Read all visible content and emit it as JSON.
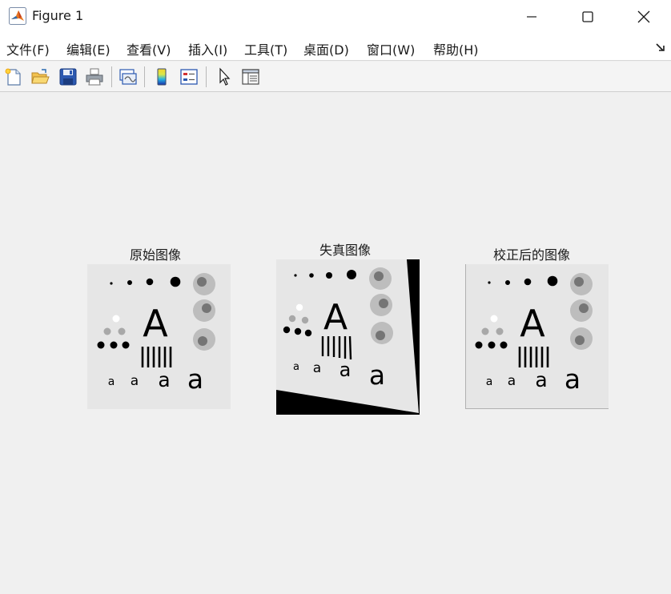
{
  "window": {
    "title": "Figure 1"
  },
  "menu": {
    "items": [
      {
        "label": "文件(F)"
      },
      {
        "label": "编辑(E)"
      },
      {
        "label": "查看(V)"
      },
      {
        "label": "插入(I)"
      },
      {
        "label": "工具(T)"
      },
      {
        "label": "桌面(D)"
      },
      {
        "label": "窗口(W)"
      },
      {
        "label": "帮助(H)"
      }
    ]
  },
  "toolbar": {
    "buttons": [
      {
        "icon": "new-figure-icon"
      },
      {
        "icon": "open-file-icon"
      },
      {
        "icon": "save-icon"
      },
      {
        "icon": "print-icon"
      },
      {
        "icon": "link-plot-icon"
      },
      {
        "icon": "insert-colorbar-icon"
      },
      {
        "icon": "insert-legend-icon"
      },
      {
        "icon": "edit-plot-pointer-icon"
      },
      {
        "icon": "property-inspector-icon"
      }
    ]
  },
  "figure": {
    "axes": [
      {
        "title": "原始图像"
      },
      {
        "title": "失真图像"
      },
      {
        "title": "校正后的图像"
      }
    ],
    "test_image": {
      "big_letter": "A",
      "small_letter": "a"
    }
  },
  "colors": {
    "window_bg": "#f0f0f0",
    "image_bg": "#e6e6e6",
    "ink": "#000000",
    "gray_dot": "#a8a8a8"
  }
}
